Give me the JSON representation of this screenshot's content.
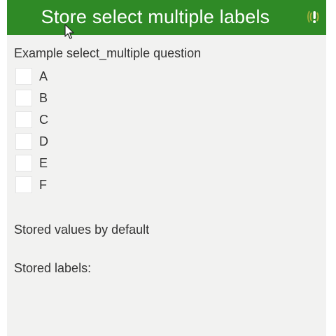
{
  "header": {
    "title": "Store select multiple labels",
    "background_color": "#2f8a26",
    "status_icon": "warning-icon"
  },
  "question": {
    "label": "Example select_multiple question",
    "options": [
      {
        "label": "A",
        "checked": false
      },
      {
        "label": "B",
        "checked": false
      },
      {
        "label": "C",
        "checked": false
      },
      {
        "label": "D",
        "checked": false
      },
      {
        "label": "E",
        "checked": false
      },
      {
        "label": "F",
        "checked": false
      }
    ]
  },
  "notes": {
    "stored_values": "Stored values by default",
    "stored_labels": "Stored labels:"
  }
}
